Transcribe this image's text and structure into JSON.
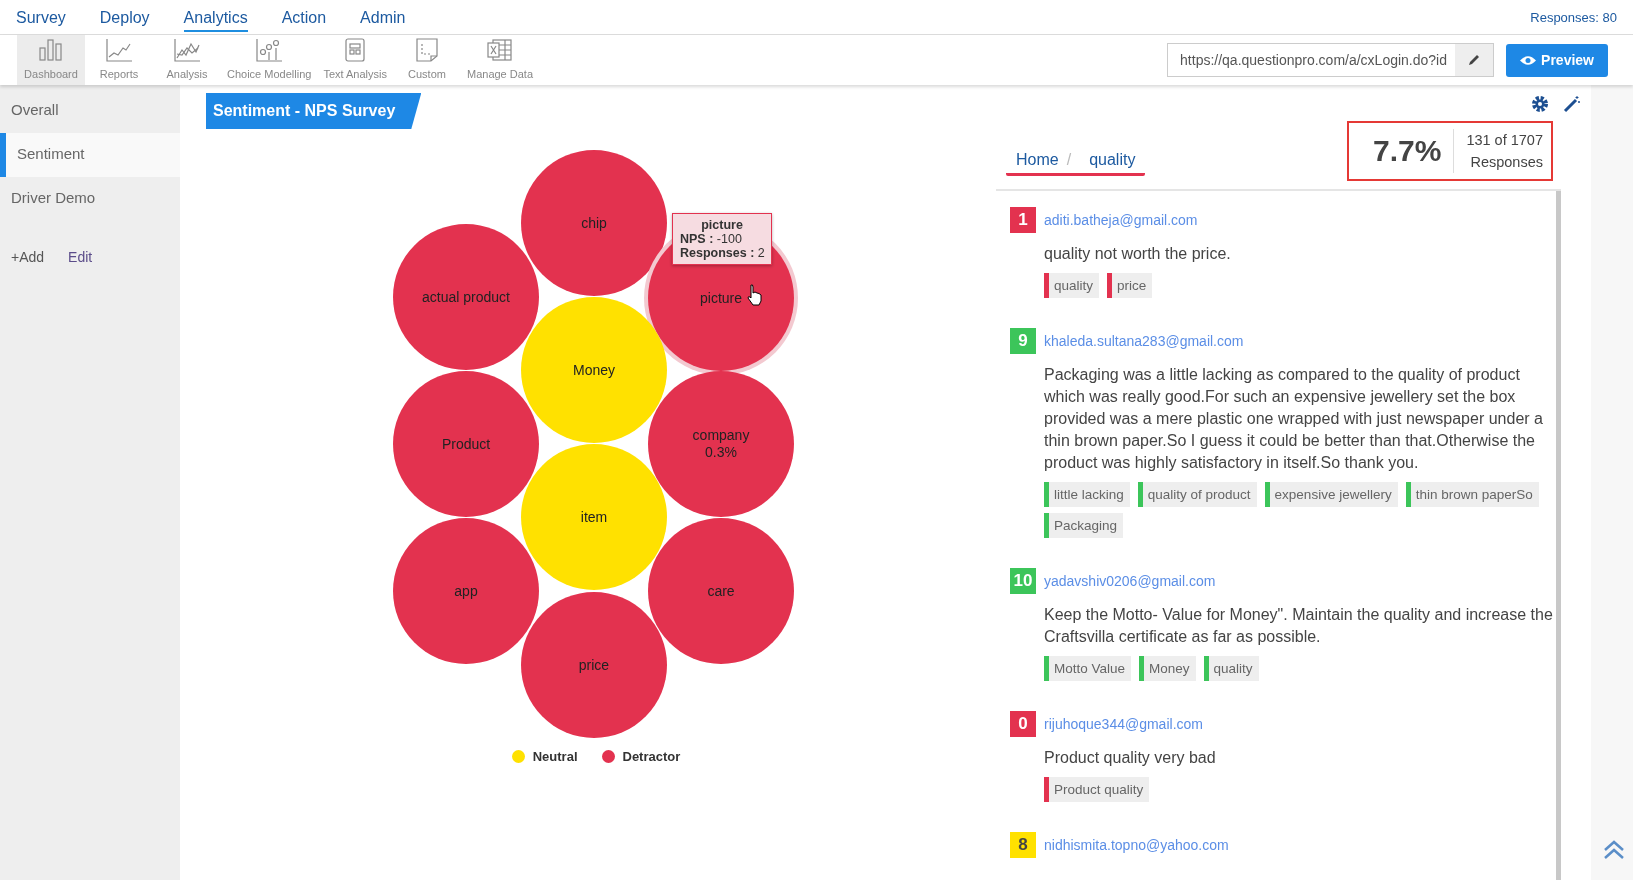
{
  "nav": {
    "items": [
      {
        "label": "Survey",
        "selected": false
      },
      {
        "label": "Deploy",
        "selected": false
      },
      {
        "label": "Analytics",
        "selected": true
      },
      {
        "label": "Action",
        "selected": false
      },
      {
        "label": "Admin",
        "selected": false
      }
    ],
    "responses": "Responses: 80"
  },
  "toolbar": {
    "items": [
      {
        "label": "Dashboard",
        "selected": true
      },
      {
        "label": "Reports",
        "selected": false
      },
      {
        "label": "Analysis",
        "selected": false
      },
      {
        "label": "Choice Modelling",
        "selected": false
      },
      {
        "label": "Text Analysis",
        "selected": false
      },
      {
        "label": "Custom",
        "selected": false
      },
      {
        "label": "Manage Data",
        "selected": false
      }
    ],
    "url": "https://qa.questionpro.com/a/cxLogin.do?id",
    "preview": "Preview"
  },
  "sidebar": {
    "items": [
      {
        "label": "Overall",
        "selected": false
      },
      {
        "label": "Sentiment",
        "selected": true
      },
      {
        "label": "Driver Demo",
        "selected": false
      }
    ],
    "add": "+Add",
    "edit": "Edit"
  },
  "panel": {
    "title": "Sentiment - NPS Survey",
    "bubbles": [
      {
        "label": "chip",
        "color": "#e3324f",
        "hovered": false
      },
      {
        "label": "actual product",
        "color": "#e3324f",
        "hovered": false
      },
      {
        "label": "picture",
        "color": "#e3324f",
        "hovered": true
      },
      {
        "label": "Money",
        "color": "#ffe100",
        "hovered": false
      },
      {
        "label": "Product",
        "color": "#e3324f",
        "hovered": false
      },
      {
        "label": "company",
        "note": "0.3%",
        "color": "#e3324f",
        "hovered": false
      },
      {
        "label": "item",
        "color": "#ffe100",
        "hovered": false
      },
      {
        "label": "app",
        "color": "#e3324f",
        "hovered": false
      },
      {
        "label": "care",
        "color": "#e3324f",
        "hovered": false
      },
      {
        "label": "price",
        "color": "#e3324f",
        "hovered": false
      }
    ],
    "tooltip": {
      "title": "picture",
      "lines": [
        "**NPS :** -100",
        "**Responses :** 2"
      ]
    },
    "legend": [
      {
        "label": "Neutral",
        "color": "#ffe100"
      },
      {
        "label": "Detractor",
        "color": "#e3324f"
      }
    ]
  },
  "detail": {
    "breadcrumb": {
      "home": "Home",
      "separator": "/",
      "current": "quality"
    },
    "stats": {
      "percent": "7.7%",
      "count": "131 of 1707",
      "label": "Responses"
    },
    "responses": [
      {
        "score": "1",
        "color": "#e3324f",
        "email": "aditi.batheja@gmail.com",
        "text": "quality not worth the price.",
        "tags": [
          {
            "label": "quality",
            "color": "#e3324f"
          },
          {
            "label": "price",
            "color": "#e3324f"
          }
        ]
      },
      {
        "score": "9",
        "color": "#3cc55a",
        "email": "khaleda.sultana283@gmail.com",
        "text": "Packaging was a little lacking as compared to the quality of product which was really good.For such an expensive jewellery set the box provided was a mere plastic one wrapped with just newspaper under a thin brown paper.So I guess it could be better than that.Otherwise the product was highly satisfactory in itself.So thank you.",
        "tags": [
          {
            "label": "little lacking",
            "color": "#3cc55a"
          },
          {
            "label": "quality of product",
            "color": "#3cc55a"
          },
          {
            "label": "expensive jewellery",
            "color": "#3cc55a"
          },
          {
            "label": "thin brown paperSo",
            "color": "#3cc55a"
          },
          {
            "label": "Packaging",
            "color": "#3cc55a"
          }
        ]
      },
      {
        "score": "10",
        "color": "#3cc55a",
        "email": "yadavshiv0206@gmail.com",
        "text": "Keep the Motto- Value for Money\". Maintain the quality and increase the Craftsvilla certificate as far as possible.",
        "tags": [
          {
            "label": "Motto Value",
            "color": "#3cc55a"
          },
          {
            "label": "Money",
            "color": "#3cc55a"
          },
          {
            "label": "quality",
            "color": "#3cc55a"
          }
        ]
      },
      {
        "score": "0",
        "color": "#e3324f",
        "email": "rijuhoque344@gmail.com",
        "text": "Product quality very bad",
        "tags": [
          {
            "label": "Product quality",
            "color": "#e3324f"
          }
        ]
      },
      {
        "score": "8",
        "color": "#ffe100",
        "email": "nidhismita.topno@yahoo.com"
      }
    ]
  }
}
